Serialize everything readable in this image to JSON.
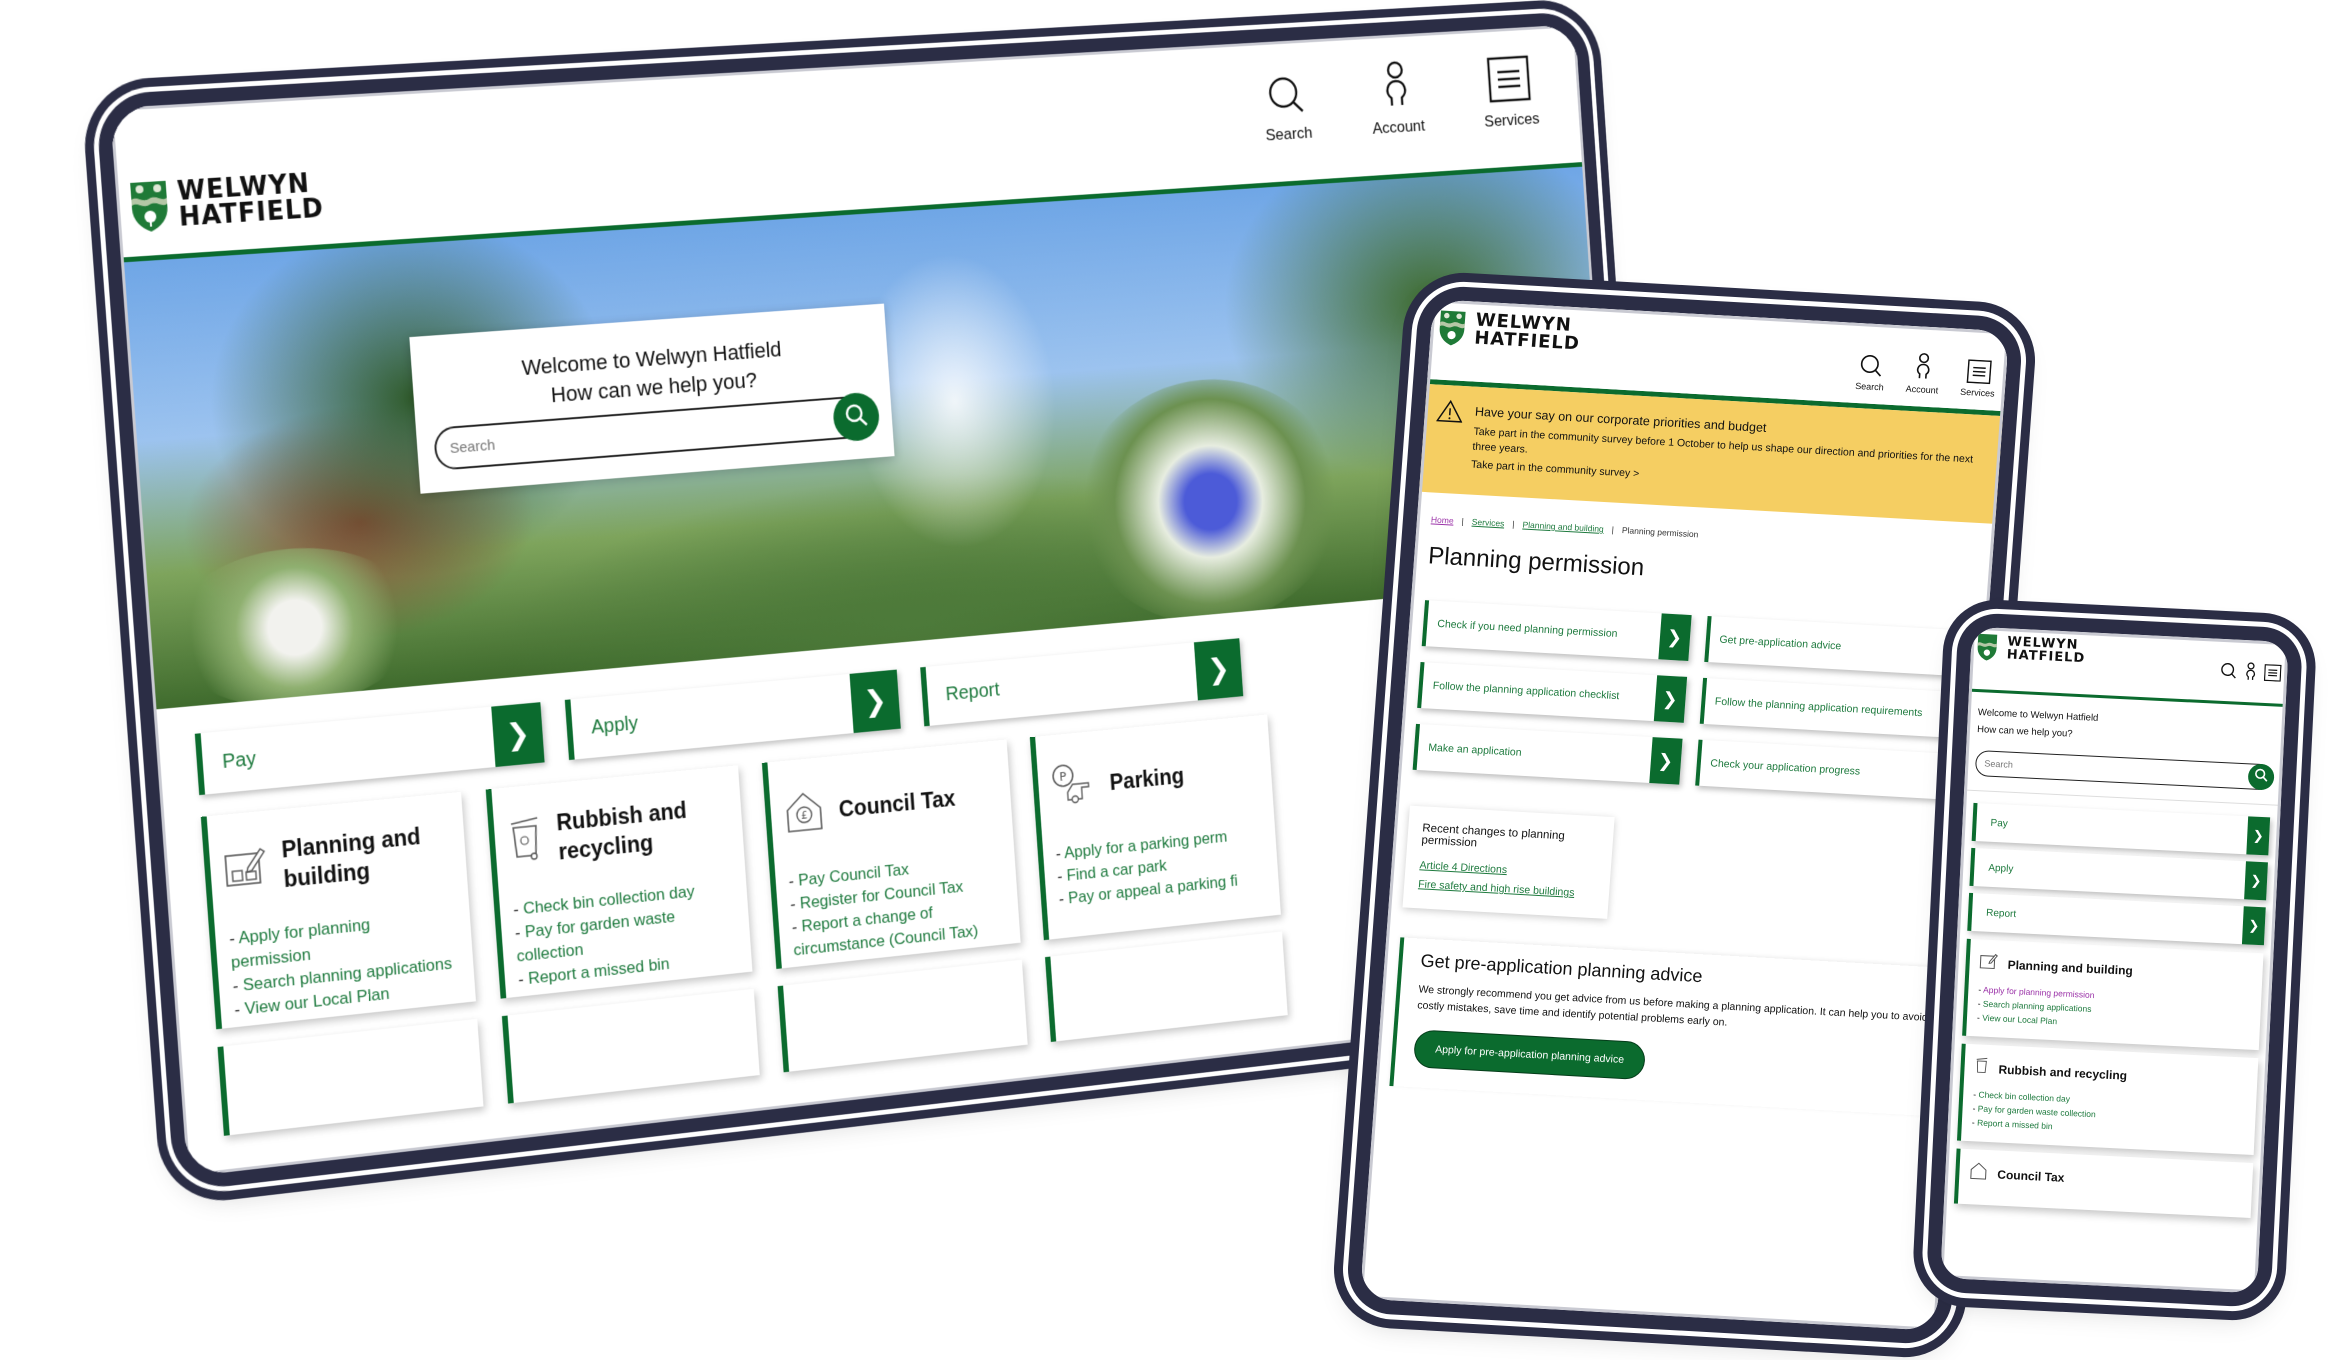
{
  "brand": {
    "name_line1": "WELWYN",
    "name_line2": "HATFIELD",
    "colors": {
      "primary_green": "#0b6b2e",
      "device_frame": "#2b2d45",
      "alert_yellow": "#f5ce62",
      "visited_link": "#9b33a8"
    }
  },
  "nav": {
    "items": [
      {
        "label": "Search",
        "icon": "search-icon"
      },
      {
        "label": "Account",
        "icon": "account-icon"
      },
      {
        "label": "Services",
        "icon": "services-menu-icon"
      }
    ]
  },
  "desktop": {
    "hero": {
      "line1": "Welcome to Welwyn Hatfield",
      "line2": "How can we help you?",
      "search_placeholder": "Search"
    },
    "quick_links": [
      {
        "label": "Pay"
      },
      {
        "label": "Apply"
      },
      {
        "label": "Report"
      }
    ],
    "cards": [
      {
        "title": "Planning and building",
        "icon": "planning-icon",
        "links": [
          "Apply for planning permission",
          "Search planning applications",
          "View our Local Plan"
        ]
      },
      {
        "title": "Rubbish and recycling",
        "icon": "wheelie-bin-icon",
        "links": [
          "Check bin collection day",
          "Pay for garden waste collection",
          "Report a missed bin"
        ]
      },
      {
        "title": "Council Tax",
        "icon": "council-tax-house-icon",
        "links": [
          "Pay Council Tax",
          "Register for Council Tax",
          "Report a change of circumstance (Council Tax)"
        ]
      },
      {
        "title": "Parking",
        "icon": "parking-car-icon",
        "links": [
          "Apply for a parking perm",
          "Find a car park",
          "Pay or appeal a parking fi"
        ]
      }
    ]
  },
  "tablet": {
    "banner": {
      "icon": "warning-icon",
      "title": "Have your say on our corporate priorities and budget",
      "text": "Take part in the community survey before 1 October to help us shape our direction and priorities for the next three years.",
      "link": "Take part in the community survey >"
    },
    "breadcrumbs": [
      {
        "label": "Home",
        "link": true,
        "visited": true
      },
      {
        "label": "Services",
        "link": true
      },
      {
        "label": "Planning and building",
        "link": true
      },
      {
        "label": "Planning permission",
        "link": false
      }
    ],
    "page_title": "Planning permission",
    "links": [
      {
        "label": "Check if you need planning permission",
        "arrow": true
      },
      {
        "label": "Get pre-application advice",
        "arrow": false
      },
      {
        "label": "Follow the planning application checklist",
        "arrow": true
      },
      {
        "label": "Follow the planning application requirements",
        "arrow": false
      },
      {
        "label": "Make an application",
        "arrow": true
      },
      {
        "label": "Check your application progress",
        "arrow": false
      }
    ],
    "recent": {
      "title": "Recent changes to planning permission",
      "links": [
        "Article 4 Directions",
        "Fire safety and high rise buildings"
      ]
    },
    "advice": {
      "title": "Get pre-application planning advice",
      "text": "We strongly recommend you get advice from us before making a planning application. It can help you to avoid costly mistakes, save time and identify potential problems early on.",
      "button": "Apply for pre-application planning advice"
    }
  },
  "phone": {
    "welcome_line1": "Welcome to Welwyn Hatfield",
    "welcome_line2": "How can we help you?",
    "search_placeholder": "Search",
    "quick_links": [
      {
        "label": "Pay"
      },
      {
        "label": "Apply"
      },
      {
        "label": "Report"
      }
    ],
    "cards": [
      {
        "title": "Planning and building",
        "links": [
          "Apply for planning permission",
          "Search planning applications",
          "View our Local Plan"
        ],
        "visited_index": 0
      },
      {
        "title": "Rubbish and recycling",
        "links": [
          "Check bin collection day",
          "Pay for garden waste collection",
          "Report a missed bin"
        ]
      },
      {
        "title": "Council Tax",
        "links": []
      }
    ]
  }
}
